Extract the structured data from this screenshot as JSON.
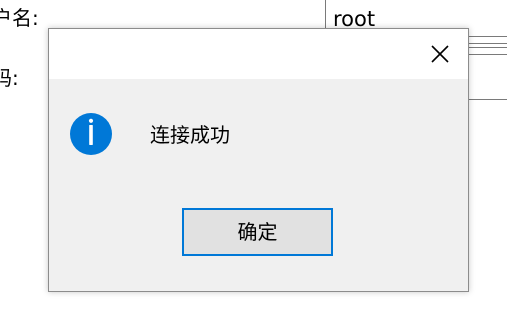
{
  "background_form": {
    "username_label": "户名:",
    "password_label": "码:",
    "username_value": "root"
  },
  "dialog": {
    "message": "连接成功",
    "ok_label": "确定",
    "icon": "info-icon",
    "close_icon": "close-icon"
  },
  "colors": {
    "accent": "#0078d7",
    "dialog_bg": "#f0f0f0",
    "button_bg": "#e1e1e1"
  }
}
